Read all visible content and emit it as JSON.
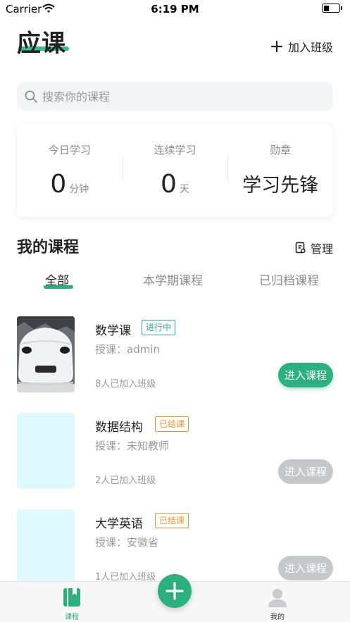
{
  "status_bar": {
    "carrier": "Carrier",
    "time": "6:19 PM",
    "battery_level": 0.35
  },
  "header": {
    "title": "应课",
    "join_class_label": "加入班级",
    "accent_color": "#2bb07e"
  },
  "search": {
    "placeholder": "搜索你的课程"
  },
  "stats": [
    {
      "label": "今日学习",
      "value": "0",
      "unit": "分钟"
    },
    {
      "label": "连续学习",
      "value": "0",
      "unit": "天"
    },
    {
      "label": "勋章",
      "badge": "学习先锋"
    }
  ],
  "my_courses": {
    "title": "我的课程",
    "manage_label": "管理",
    "tabs": [
      {
        "label": "全部",
        "active": true
      },
      {
        "label": "本学期课程",
        "active": false
      },
      {
        "label": "已归档课程",
        "active": false
      }
    ],
    "courses": [
      {
        "name": "数学课",
        "status": "进行中",
        "teacher": "授课：admin",
        "joined": "8人已加入班级",
        "button": "进入课程",
        "thumbnail": "snow-covered-car"
      },
      {
        "name": "数据结构",
        "status": "已结课",
        "teacher": "授课：未知教师",
        "joined": "2人已加入班级",
        "button": "进入课程",
        "thumbnail": "blank-cyan"
      },
      {
        "name": "大学英语",
        "status": "已结课",
        "teacher": "授课：安徽省",
        "joined": "1人已加入班级",
        "button": "进入课程",
        "thumbnail": "blank-cyan"
      }
    ]
  },
  "tabbar": {
    "items": [
      {
        "label": "课程",
        "icon": "book-icon",
        "active": true
      },
      {
        "label": "我的",
        "icon": "user-icon",
        "active": false
      }
    ],
    "fab_icon": "plus-icon"
  }
}
